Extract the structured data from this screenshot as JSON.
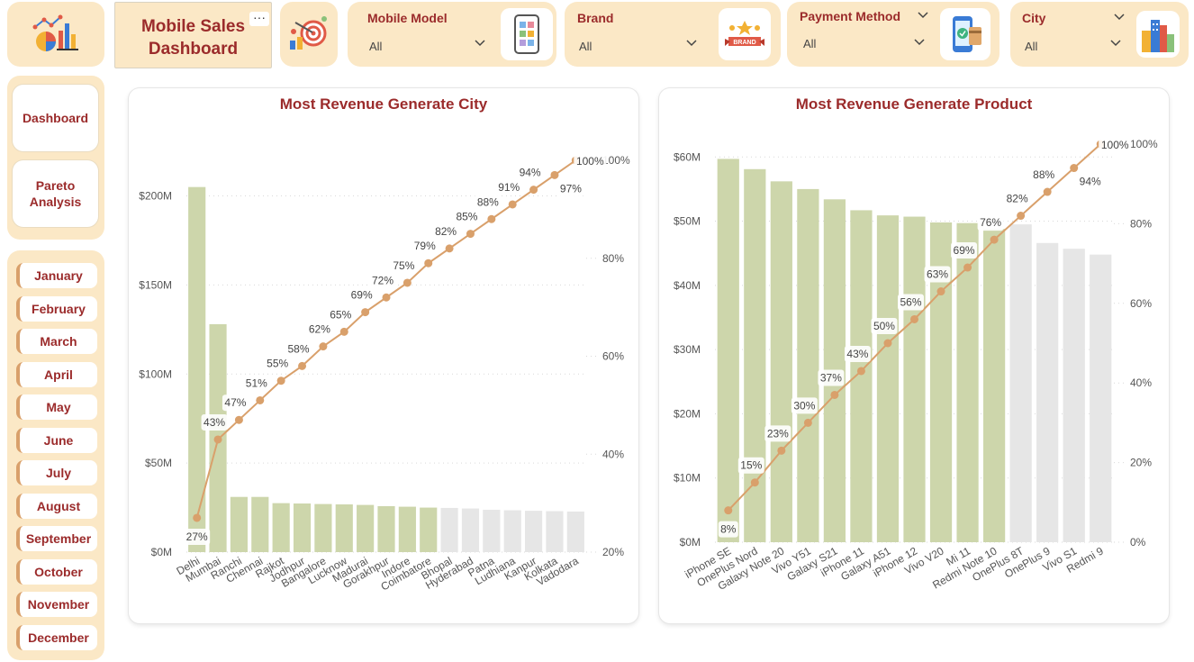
{
  "header": {
    "title_line1": "Mobile Sales",
    "title_line2": "Dashboard",
    "more_label": "···"
  },
  "filters": [
    {
      "label": "Mobile Model",
      "value": "All",
      "icon": "phone-apps-icon"
    },
    {
      "label": "Brand",
      "value": "All",
      "icon": "brand-banner-icon"
    },
    {
      "label": "Payment Method",
      "value": "All",
      "icon": "phone-payment-icon"
    },
    {
      "label": "City",
      "value": "All",
      "icon": "city-buildings-icon"
    }
  ],
  "nav": {
    "dashboard_label": "Dashboard",
    "pareto_label": "Pareto Analysis"
  },
  "months": [
    "January",
    "February",
    "March",
    "April",
    "May",
    "June",
    "July",
    "August",
    "September",
    "October",
    "November",
    "December"
  ],
  "colors": {
    "accent": "#9b2b2b",
    "panel": "#fbe8c6",
    "bar_top": "#cdd6ab",
    "bar_rest": "#e6e6e6",
    "line": "#d9a06b"
  },
  "chart_data": [
    {
      "type": "bar",
      "title": "Most Revenue Generate City",
      "categories": [
        "Delhi",
        "Mumbai",
        "Ranchi",
        "Chennai",
        "Rajkot",
        "Jodhpur",
        "Bangalore",
        "Lucknow",
        "Madurai",
        "Gorakhpur",
        "Indore",
        "Coimbatore",
        "Bhopal",
        "Hyderabad",
        "Patna",
        "Ludhiana",
        "Kanpur",
        "Kolkata",
        "Vadodara"
      ],
      "values": [
        205,
        128,
        31,
        31,
        27.5,
        27.3,
        27,
        26.8,
        26.5,
        25.8,
        25.5,
        25,
        24.8,
        24.5,
        23.8,
        23.5,
        23.2,
        23,
        22.8
      ],
      "highlight_count": 12,
      "cumulative_pct": [
        27,
        43,
        47,
        51,
        55,
        58,
        62,
        65,
        69,
        72,
        75,
        79,
        82,
        85,
        88,
        91,
        94,
        97,
        100
      ],
      "y_ticks": [
        "$0M",
        "$50M",
        "$100M",
        "$150M",
        "$200M"
      ],
      "ylim": [
        0,
        220
      ],
      "y2_ticks": [
        "20%",
        "40%",
        "60%",
        "80%",
        "100%"
      ],
      "y2lim": [
        20,
        100
      ]
    },
    {
      "type": "bar",
      "title": "Most Revenue Generate Product",
      "categories": [
        "iPhone SE",
        "OnePlus Nord",
        "Galaxy Note 20",
        "Vivo Y51",
        "Galaxy S21",
        "iPhone 11",
        "Galaxy A51",
        "iPhone 12",
        "Vivo V20",
        "Mi 11",
        "Redmi Note 10",
        "OnePlus 8T",
        "OnePlus 9",
        "Vivo S1",
        "Redmi 9"
      ],
      "values": [
        59.7,
        58.1,
        56.2,
        55,
        53.4,
        51.7,
        50.9,
        50.7,
        49.8,
        49.7,
        48.8,
        49.5,
        46.6,
        45.7,
        44.8
      ],
      "highlight_count": 11,
      "cumulative_pct": [
        8,
        15,
        23,
        30,
        37,
        43,
        50,
        56,
        63,
        69,
        76,
        82,
        88,
        94,
        100
      ],
      "y_ticks": [
        "$0M",
        "$10M",
        "$20M",
        "$30M",
        "$40M",
        "$50M",
        "$60M"
      ],
      "ylim": [
        0,
        62
      ],
      "y2_ticks": [
        "0%",
        "20%",
        "40%",
        "60%",
        "80%",
        "100%"
      ],
      "y2lim": [
        0,
        100
      ]
    }
  ]
}
